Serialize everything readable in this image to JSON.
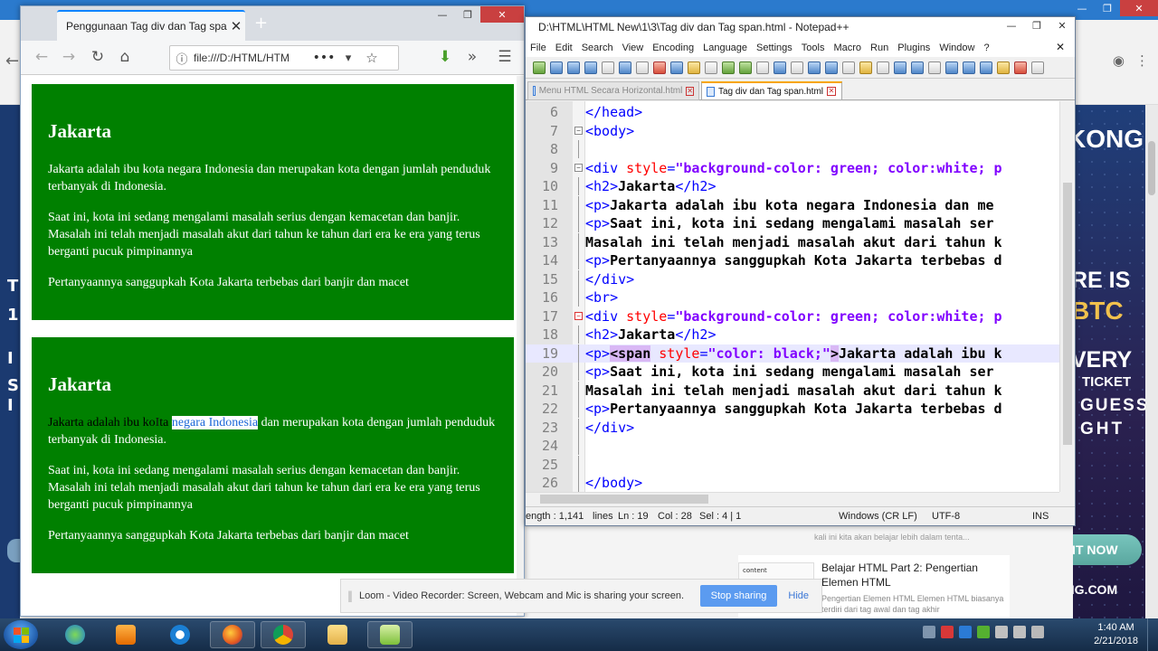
{
  "firefox": {
    "tab_title": "Penggunaan Tag div dan Tag span",
    "url": "file:///D:/HTML/HTM",
    "boxes": [
      {
        "heading": "Jakarta",
        "p1": "Jakarta adalah ibu kota negara Indonesia dan merupakan kota dengan jumlah penduduk terbanyak di Indonesia.",
        "p2": "Saat ini, kota ini sedang mengalami masalah serius dengan kemacetan dan banjir. Masalah ini telah menjadi masalah akut dari tahun ke tahun dari era ke era yang terus berganti pucuk pimpinannya",
        "p3": "Pertanyaannya sanggupkah Kota Jakarta terbebas dari banjir dan macet"
      },
      {
        "heading": "Jakarta",
        "p1_black": "Jakarta adalah ibu ko",
        "p1_black2": "ta ",
        "p1_selected": "negara Indonesia",
        "p1_rest": " dan merupakan kota dengan jumlah penduduk terbanyak di Indonesia.",
        "p2": "Saat ini, kota ini sedang mengalami masalah serius dengan kemacetan dan banjir. Masalah ini telah menjadi masalah akut dari tahun ke tahun dari era ke era yang terus berganti pucuk pimpinannya",
        "p3": "Pertanyaannya sanggupkah Kota Jakarta terbebas dari banjir dan macet"
      }
    ]
  },
  "notepad": {
    "title": "D:\\HTML\\HTML New\\1\\3\\Tag div dan Tag span.html - Notepad++",
    "menu": [
      "File",
      "Edit",
      "Search",
      "View",
      "Encoding",
      "Language",
      "Settings",
      "Tools",
      "Macro",
      "Run",
      "Plugins",
      "Window",
      "?"
    ],
    "tabs": [
      {
        "label": "Menu HTML Secara Horizontal.html",
        "active": false
      },
      {
        "label": "Tag div dan Tag span.html",
        "active": true
      }
    ],
    "lines": [
      {
        "n": "6",
        "segs": [
          [
            "tg",
            "</head>"
          ]
        ]
      },
      {
        "n": "7",
        "segs": [
          [
            "tg",
            "<body>"
          ]
        ]
      },
      {
        "n": "8",
        "segs": []
      },
      {
        "n": "9",
        "segs": [
          [
            "tg",
            "<div "
          ],
          [
            "at",
            "style"
          ],
          [
            "tg",
            "="
          ],
          [
            "vl",
            "\"background-color: green; color:white; p"
          ]
        ]
      },
      {
        "n": "10",
        "segs": [
          [
            "tg",
            "<h2>"
          ],
          [
            "tx2",
            "Jakarta"
          ],
          [
            "tg",
            "</h2>"
          ]
        ]
      },
      {
        "n": "11",
        "segs": [
          [
            "tg",
            "<p>"
          ],
          [
            "tx2",
            "Jakarta adalah ibu kota negara Indonesia dan me"
          ]
        ]
      },
      {
        "n": "12",
        "segs": [
          [
            "tg",
            "<p>"
          ],
          [
            "tx2",
            "Saat ini, kota ini sedang mengalami masalah ser"
          ]
        ]
      },
      {
        "n": "13",
        "segs": [
          [
            "tx2",
            "Masalah ini telah menjadi masalah akut dari tahun k"
          ]
        ]
      },
      {
        "n": "14",
        "segs": [
          [
            "tg",
            "<p>"
          ],
          [
            "tx2",
            "Pertanyaannya sanggupkah Kota Jakarta terbebas d"
          ]
        ]
      },
      {
        "n": "15",
        "segs": [
          [
            "tg",
            "</div>"
          ]
        ]
      },
      {
        "n": "16",
        "segs": [
          [
            "tg",
            "<br>"
          ]
        ]
      },
      {
        "n": "17",
        "segs": [
          [
            "tg",
            "<div "
          ],
          [
            "at",
            "style"
          ],
          [
            "tg",
            "="
          ],
          [
            "vl",
            "\"background-color: green; color:white; p"
          ]
        ]
      },
      {
        "n": "18",
        "segs": [
          [
            "tg",
            "<h2>"
          ],
          [
            "tx2",
            "Jakarta"
          ],
          [
            "tg",
            "</h2>"
          ]
        ]
      },
      {
        "n": "19",
        "segs": [
          [
            "tg",
            "<p>"
          ],
          [
            "mt",
            "<span"
          ],
          [
            "at",
            " style"
          ],
          [
            "tg",
            "="
          ],
          [
            "vl",
            "\"color: black;\""
          ],
          [
            "mt",
            ">"
          ],
          [
            "tx2",
            "Jakarta adalah ibu k"
          ]
        ]
      },
      {
        "n": "20",
        "segs": [
          [
            "tg",
            "<p>"
          ],
          [
            "tx2",
            "Saat ini, kota ini sedang mengalami masalah ser"
          ]
        ]
      },
      {
        "n": "21",
        "segs": [
          [
            "tx2",
            "Masalah ini telah menjadi masalah akut dari tahun k"
          ]
        ]
      },
      {
        "n": "22",
        "segs": [
          [
            "tg",
            "<p>"
          ],
          [
            "tx2",
            "Pertanyaannya sanggupkah Kota Jakarta terbebas d"
          ]
        ]
      },
      {
        "n": "23",
        "segs": [
          [
            "tg",
            "</div>"
          ]
        ]
      },
      {
        "n": "24",
        "segs": []
      },
      {
        "n": "25",
        "segs": []
      },
      {
        "n": "26",
        "segs": [
          [
            "tg",
            "</body>"
          ]
        ]
      }
    ],
    "status": {
      "length": "ength : 1,141",
      "lines": "lines",
      "ln": "Ln : 19",
      "col": "Col : 28",
      "sel": "Sel : 4 | 1",
      "eol": "Windows (CR LF)",
      "encoding": "UTF-8",
      "mode": "INS"
    }
  },
  "loom": {
    "message": "Loom - Video Recorder: Screen, Webcam and Mic is sharing your screen.",
    "stop": "Stop sharing",
    "hide": "Hide"
  },
  "ad": {
    "lines": [
      "KONG",
      "RE IS",
      "BTC",
      "VERY",
      "TICKET",
      "GUESS",
      "GHT"
    ],
    "cta": "GET IT NOW",
    "domain": "BITKONG.COM"
  },
  "bg_left": [
    "T",
    "1",
    "I",
    "S",
    "I"
  ],
  "article": {
    "thumb_text": "content",
    "title": "Belajar HTML Part 2: Pengertian Elemen HTML",
    "snippet": "Pengertian Elemen HTML Elemen HTML biasanya terdiri dari tag awal dan tag akhir",
    "snippet_top": "kali ini kita akan belajar lebih dalam tenta..."
  },
  "taskbar": {
    "time": "1:40 AM",
    "date": "2/21/2018"
  }
}
